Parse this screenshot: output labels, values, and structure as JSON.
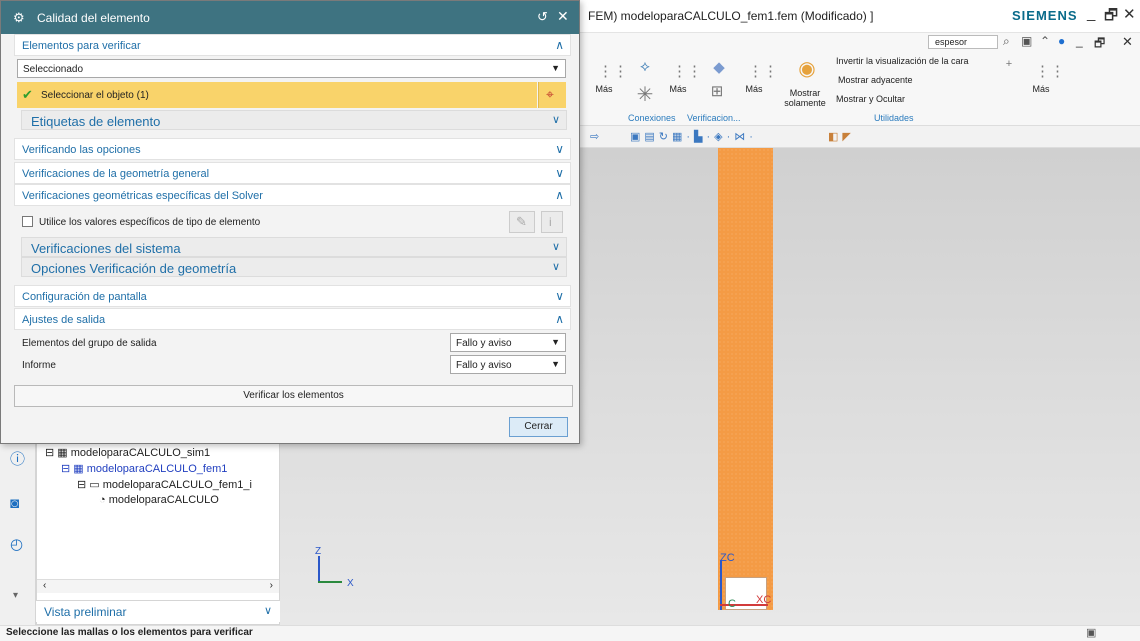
{
  "main_window": {
    "title": "FEM) modeloparaCALCULO_fem1.fem (Modificado) ]",
    "brand": "SIEMENS",
    "search_value": "espesor"
  },
  "ribbon": {
    "mas_label": "Más",
    "mostrar_solamente": "Mostrar solamente",
    "invertir": "Invertir la visualización de la cara",
    "mostrar_adyacente": "Mostrar adyacente",
    "mostrar_ocultar": "Mostrar y Ocultar",
    "group_conexiones": "Conexiones",
    "group_verificacion": "Verificacion...",
    "group_utilidades": "Utilidades"
  },
  "dialog": {
    "title": "Calidad del elemento",
    "sections": {
      "elementos_verificar": "Elementos para verificar",
      "verificando_opciones": "Verificando las opciones",
      "verificaciones_geometria_general": "Verificaciones de la geometría general",
      "verificaciones_solver": "Verificaciones geométricas específicas del Solver",
      "configuracion_pantalla": "Configuración de pantalla",
      "ajustes_salida": "Ajustes de salida"
    },
    "selection_type": "Seleccionado",
    "select_object": "Seleccionar el objeto (1)",
    "etiquetas": "Etiquetas de elemento",
    "checkbox_label": "Utilice los valores específicos de tipo de elemento",
    "verificaciones_sistema": "Verificaciones del sistema",
    "opciones_geometria": "Opciones Verificación de geometría",
    "output_group_label": "Elementos del grupo de salida",
    "output_group_value": "Fallo y aviso",
    "informe_label": "Informe",
    "informe_value": "Fallo y aviso",
    "verify_button": "Verificar los elementos",
    "close_button": "Cerrar"
  },
  "navigator": {
    "tree": [
      "modeloparaCALCULO_sim1",
      "modeloparaCALCULO_fem1",
      "modeloparaCALCULO_fem1_i",
      "modeloparaCALCULO"
    ],
    "preview": "Vista preliminar"
  },
  "axes": {
    "z": "Z",
    "x": "X",
    "zc": "ZC",
    "xc": "XC",
    "c": "C"
  },
  "status": "Seleccione las mallas o los elementos para verificar",
  "colors": {
    "dialog_title": "#3e7381",
    "highlight": "#f9d36a",
    "mesh": "#f49b45",
    "link": "#1f6fa8"
  }
}
